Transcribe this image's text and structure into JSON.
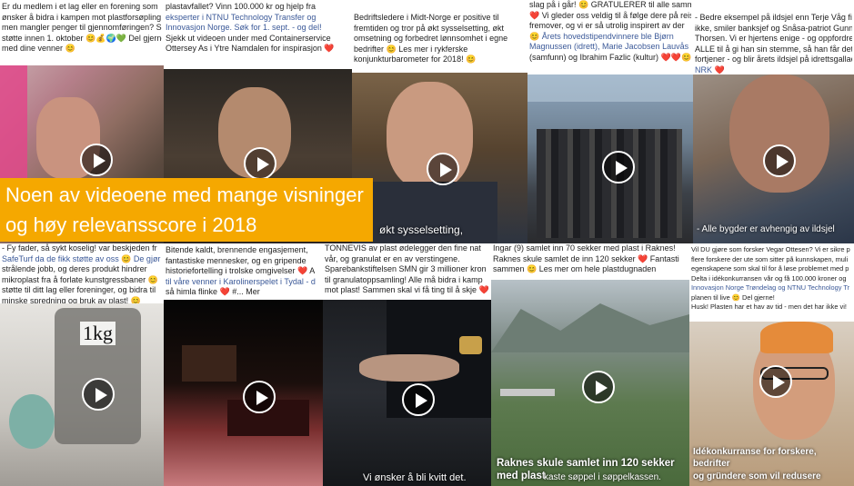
{
  "banner": {
    "line1": "Noen av videoene med mange visninger",
    "line2": "og høy relevansscore i 2018"
  },
  "colors": {
    "banner_bg": "#f5a800",
    "link": "#3b5998"
  },
  "tiles": {
    "t1": {
      "lines": [
        "Er du medlem i et lag eller en forening som",
        "ønsker å bidra i kampen mot plastforsøpling",
        "men mangler penger til gjennomføringen? S",
        "støtte innen 1. oktober 😊💰🌍💚 Del gjerne",
        "med dine venner 😊"
      ]
    },
    "t2": {
      "lines": [
        "plastavfallet? Vinn 100.000 kr og hjelp fra",
        "eksperter i NTNU Technology Transfer og",
        "Innovasjon Norge. Søk for 1. sept. - og del!",
        "Sjekk ut videoen under med Containerservice",
        "Ottersey As i Ytre Namdalen for inspirasjon ❤️"
      ]
    },
    "t3": {
      "lines": [
        "Bedriftsledere i Midt-Norge er positive til",
        "fremtiden og tror på økt sysselsetting, økt",
        "omsetning og forbedret lønnsomhet i egne",
        "bedrifter 😊 Les mer i rykferske",
        "konjunkturbarometer for 2018! 😊"
      ],
      "overlay": "økt sysselsetting,"
    },
    "t4": {
      "lines": [
        "slag på i går! 😊 GRATULERER til alle samm",
        "❤️ Vi gleder oss veldig til å følge dere på reis",
        "fremover, og vi er så utrolig inspirert av der",
        "😊 Årets hovedstipendvinnere ble Bjørn",
        "Magnussen (idrett), Marie Jacobsen Lauvås",
        "(samfunn) og Ibrahim Fazlic (kultur) ❤️❤️😊"
      ]
    },
    "t5": {
      "lines": [
        "- Bedre eksempel på ildsjel enn Terje Våg finne",
        "ikke, smiler banksjef og Snåsa-patriot Gunnar",
        "Thorsen. Vi er hjertens enige - og oppfordrer",
        "ALLE til å gi han sin stemme, så han får det ha",
        "fortjener - og blir årets ildsjel på idrettsgallaen t",
        "NRK ❤️"
      ],
      "overlay": "- Alle bygder er avhengig av ildsjel"
    },
    "t6": {
      "lines": [
        "- Fy fader, så sykt koselig! var beskjeden fr",
        "SafeTurf da de fikk støtte av oss 😊 De gjør",
        "strålende jobb, og deres produkt hindrer",
        "mikroplast fra å forlate kunstgressbaner 😊",
        "støtte til ditt lag eller foreninger, og bidra til",
        "minske spredning og bruk av plast! 😊"
      ],
      "label": "1kg"
    },
    "t7": {
      "lines": [
        "Bitende kaldt, brennende engasjement,",
        "fantastiske mennesker, og en gripende",
        "historiefortelling i trolske omgivelser ❤️ A",
        "til våre venner i Karolinerspelet i Tydal - d",
        "så himla flinke ❤️ #... Mer"
      ]
    },
    "t8": {
      "lines": [
        "TONNEVIS av plast ødelegger den fine nat",
        "vår, og granulat er en av verstingene.",
        "Sparebankstiftelsen SMN gir 3 millioner kron",
        "til granulatoppsamling! Alle må bidra i kamp",
        "mot plast! Sammen skal vi få ting til å skje ❤️"
      ],
      "overlay": "Vi ønsker å bli kvitt det."
    },
    "t9": {
      "lines": [
        "Ingar (9) samlet inn 70 sekker med plast i Raknes!",
        "Raknes skule samlet de inn 120 sekker ❤️ Fantasti",
        "sammen 😊 Les mer om hele plastdugnaden"
      ],
      "overlay1": "Raknes skule samlet inn 120 sekker",
      "overlay2": "med plast",
      "overlay3": "kaste søppel i søppelkassen."
    },
    "t10": {
      "lines": [
        "Vil DU gjøre som forsker Vegar Ottesen? Vi er sikre p",
        "flere forskere der ute som sitter på kunnskapen, muli",
        "egenskapene som skal til for å løse problemet med p",
        "Delta i idékonkurransen vår og få 100.000 kroner og",
        "Innovasjon Norge Trøndelag og NTNU Technology Tr",
        "planen til live 😊 Del gjerne!",
        "",
        "Husk! Plasten har et hav av tid - men det har ikke vi!"
      ],
      "overlay1": "Idékonkurranse for forskere, bedrifter",
      "overlay2": "og gründere som vil redusere"
    }
  }
}
